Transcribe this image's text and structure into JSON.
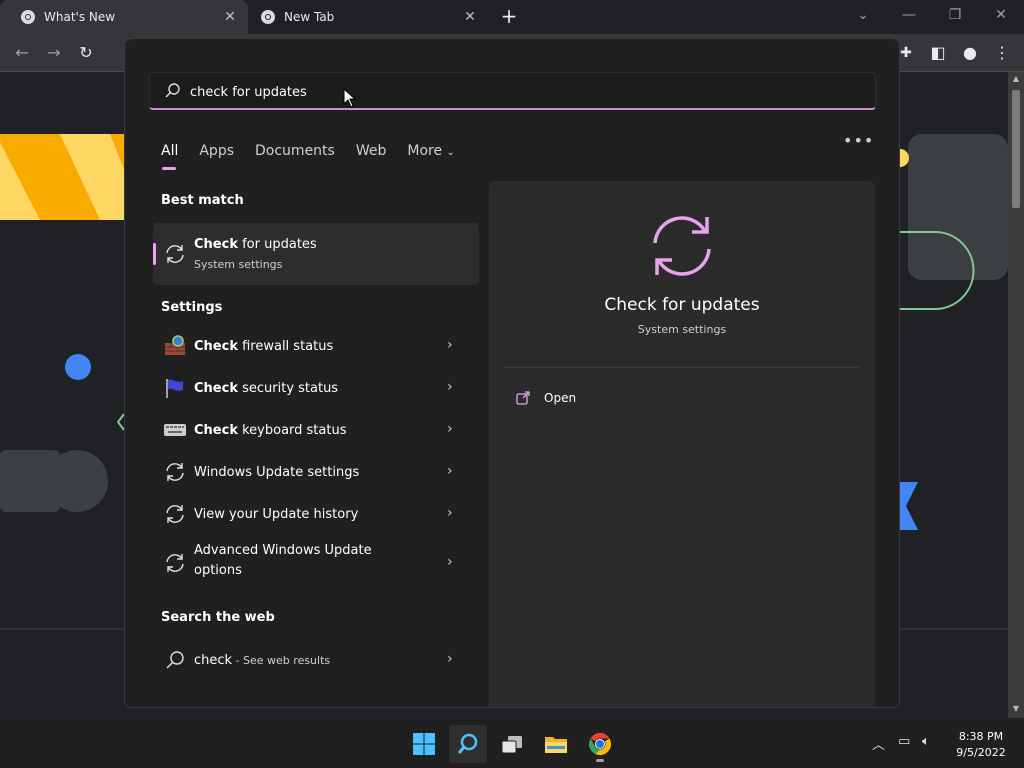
{
  "browser": {
    "tabs": [
      {
        "title": "What's New",
        "active": true
      },
      {
        "title": "New Tab",
        "active": false
      }
    ],
    "new_tab_symbol": "+",
    "window_controls": [
      "chevron-down-icon",
      "minimize-icon",
      "restore-icon",
      "close-icon"
    ]
  },
  "search": {
    "query": "check for updates",
    "filters": [
      "All",
      "Apps",
      "Documents",
      "Web",
      "More"
    ],
    "selected_filter": "All"
  },
  "best_match": {
    "header": "Best match",
    "bold": "Check",
    "rest": " for updates",
    "subtitle": "System settings"
  },
  "settings": {
    "header": "Settings",
    "items": [
      {
        "bold": "Check",
        "rest": " firewall status",
        "icon": "firewall-icon"
      },
      {
        "bold": "Check",
        "rest": " security status",
        "icon": "security-flag-icon"
      },
      {
        "bold": "Check",
        "rest": " keyboard status",
        "icon": "keyboard-icon"
      },
      {
        "bold": "",
        "rest": "Windows Update settings",
        "icon": "sync-icon"
      },
      {
        "bold": "",
        "rest": "View your Update history",
        "icon": "sync-icon"
      },
      {
        "bold": "",
        "rest": "Advanced Windows Update options",
        "icon": "sync-icon"
      }
    ]
  },
  "web": {
    "header": "Search the web",
    "term": "check",
    "suffix": " - See web results"
  },
  "detail": {
    "title": "Check for updates",
    "subtitle": "System settings",
    "open_label": "Open",
    "accent": "#e7a3ee"
  },
  "taskbar": {
    "apps": [
      "windows-start-icon",
      "search-icon",
      "task-view-icon",
      "file-explorer-icon",
      "chrome-icon"
    ],
    "time": "8:38 PM",
    "date": "9/5/2022"
  }
}
